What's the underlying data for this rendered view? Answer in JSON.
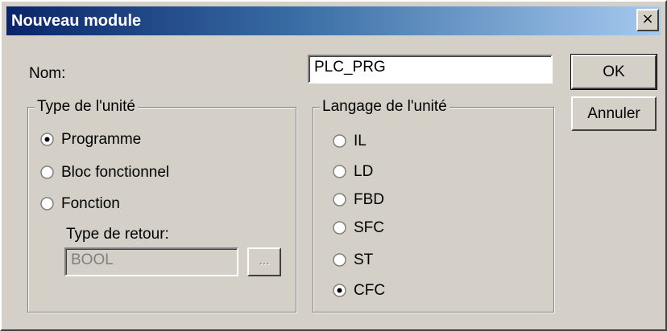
{
  "window": {
    "title": "Nouveau module",
    "close_glyph": "×"
  },
  "name_field": {
    "label": "Nom:",
    "value": "PLC_PRG"
  },
  "buttons": {
    "ok": "OK",
    "cancel": "Annuler"
  },
  "unit_type": {
    "title": "Type de l'unité",
    "options": [
      {
        "label": "Programme",
        "selected": true
      },
      {
        "label": "Bloc fonctionnel",
        "selected": false
      },
      {
        "label": "Fonction",
        "selected": false
      }
    ],
    "return_type_label": "Type de retour:",
    "return_type_value": "BOOL",
    "browse_label": "..."
  },
  "unit_language": {
    "title": "Langage de l'unité",
    "options": [
      {
        "label": "IL",
        "selected": false
      },
      {
        "label": "LD",
        "selected": false
      },
      {
        "label": "FBD",
        "selected": false
      },
      {
        "label": "SFC",
        "selected": false
      },
      {
        "label": "ST",
        "selected": false
      },
      {
        "label": "CFC",
        "selected": true
      }
    ]
  },
  "colors": {
    "dialog_face": "#d4d0c8",
    "title_gradient_start": "#0a246a",
    "title_gradient_end": "#a6caf0"
  }
}
